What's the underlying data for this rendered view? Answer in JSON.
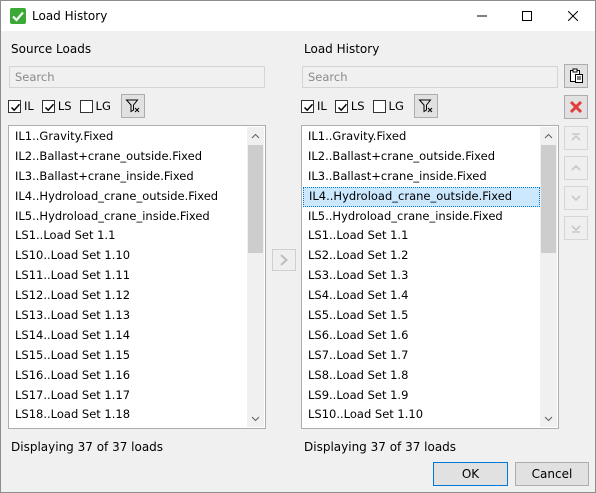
{
  "window": {
    "title": "Load History"
  },
  "source": {
    "label": "Source Loads",
    "search_placeholder": "Search",
    "filters": [
      {
        "label": "IL",
        "checked": true
      },
      {
        "label": "LS",
        "checked": true
      },
      {
        "label": "LG",
        "checked": false
      }
    ],
    "items": [
      "IL1..Gravity.Fixed",
      "IL2..Ballast+crane_outside.Fixed",
      "IL3..Ballast+crane_inside.Fixed",
      "IL4..Hydroload_crane_outside.Fixed",
      "IL5..Hydroload_crane_inside.Fixed",
      "LS1..Load Set 1.1",
      "LS10..Load Set 1.10",
      "LS11..Load Set 1.11",
      "LS12..Load Set 1.12",
      "LS13..Load Set 1.13",
      "LS14..Load Set 1.14",
      "LS15..Load Set 1.15",
      "LS16..Load Set 1.16",
      "LS17..Load Set 1.17",
      "LS18..Load Set 1.18"
    ],
    "status": "Displaying 37 of 37 loads"
  },
  "history": {
    "label": "Load History",
    "search_placeholder": "Search",
    "filters": [
      {
        "label": "IL",
        "checked": true
      },
      {
        "label": "LS",
        "checked": true
      },
      {
        "label": "LG",
        "checked": false
      }
    ],
    "selected_index": 3,
    "items": [
      "IL1..Gravity.Fixed",
      "IL2..Ballast+crane_outside.Fixed",
      "IL3..Ballast+crane_inside.Fixed",
      "IL4..Hydroload_crane_outside.Fixed",
      "IL5..Hydroload_crane_inside.Fixed",
      "LS1..Load Set 1.1",
      "LS2..Load Set 1.2",
      "LS3..Load Set 1.3",
      "LS4..Load Set 1.4",
      "LS5..Load Set 1.5",
      "LS6..Load Set 1.6",
      "LS7..Load Set 1.7",
      "LS8..Load Set 1.8",
      "LS9..Load Set 1.9",
      "LS10..Load Set 1.10"
    ],
    "status": "Displaying 37 of 37 loads"
  },
  "buttons": {
    "ok": "OK",
    "cancel": "Cancel"
  },
  "icons": {
    "app": "check-icon",
    "filter": "clear-filter-icon",
    "paste": "clipboard-icon",
    "delete": "delete-x-icon",
    "move_top": "move-top-icon",
    "move_up": "move-up-icon",
    "move_down": "move-down-icon",
    "move_bottom": "move-bottom-icon",
    "add": "arrow-right-icon"
  },
  "colors": {
    "accent": "#0078d7",
    "selection": "#cce8ff",
    "delete": "#e03c3c",
    "app_icon": "#3aa935"
  }
}
